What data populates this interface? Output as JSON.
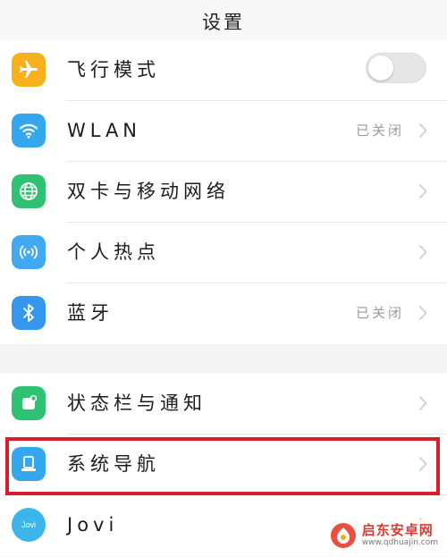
{
  "header": {
    "title": "设置"
  },
  "group1": {
    "items": [
      {
        "label": "飞行模式",
        "icon": "airplane-icon",
        "color": "#f7b21b",
        "toggle": false
      },
      {
        "label": "WLAN",
        "icon": "wifi-icon",
        "color": "#35a7ec",
        "value": "已关闭"
      },
      {
        "label": "双卡与移动网络",
        "icon": "globe-icon",
        "color": "#2fc273"
      },
      {
        "label": "个人热点",
        "icon": "hotspot-icon",
        "color": "#42a9f0"
      },
      {
        "label": "蓝牙",
        "icon": "bluetooth-icon",
        "color": "#3596ee",
        "value": "已关闭"
      }
    ]
  },
  "group2": {
    "items": [
      {
        "label": "状态栏与通知",
        "icon": "notification-icon",
        "color": "#2fc273"
      },
      {
        "label": "系统导航",
        "icon": "navigation-icon",
        "color": "#35a7ec"
      },
      {
        "label": "Jovi",
        "icon": "jovi-icon",
        "color": "#3cb6ea",
        "icon_text": "Jovi"
      }
    ]
  },
  "watermark": {
    "title": "启东安卓网",
    "url": "www.qdhuajin.com"
  }
}
